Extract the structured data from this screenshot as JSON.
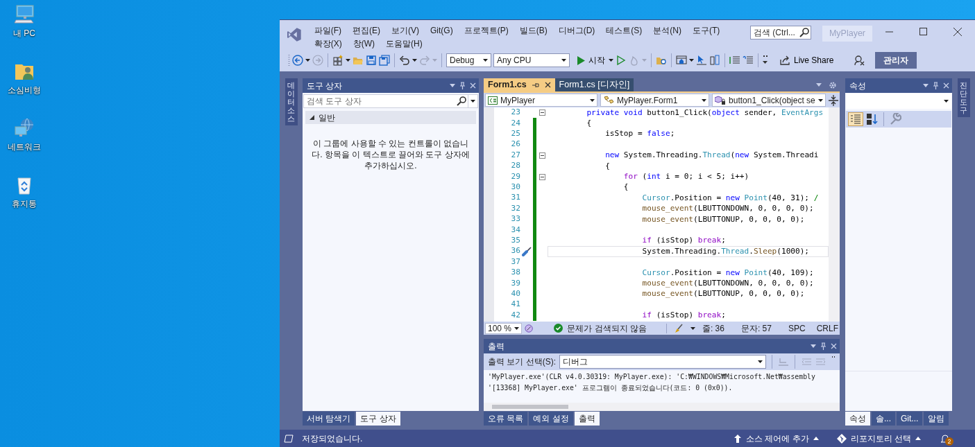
{
  "desktop_icons": [
    {
      "kind": "computer",
      "label": "내 PC"
    },
    {
      "kind": "user-folder",
      "label": "소심비형"
    },
    {
      "kind": "network",
      "label": "네트워크"
    },
    {
      "kind": "recycle-bin",
      "label": "휴지통"
    }
  ],
  "window": {
    "menu": [
      "파일(F)",
      "편집(E)",
      "보기(V)",
      "Git(G)",
      "프로젝트(P)",
      "빌드(B)",
      "디버그(D)",
      "테스트(S)",
      "분석(N)",
      "도구(T)",
      "확장(X)",
      "창(W)",
      "도움말(H)"
    ],
    "search_placeholder": "검색 (Ctrl...",
    "solution": "MyPlayer"
  },
  "toolbar": {
    "configuration": "Debug",
    "platform": "Any CPU",
    "start": "시작",
    "live_share": "Live Share",
    "admin": "관리자"
  },
  "left_strip": {
    "label": "데이터 소스"
  },
  "toolbox": {
    "title": "도구 상자",
    "search_placeholder": "검색 도구 상자",
    "group": {
      "label": "일반",
      "expanded": true
    },
    "message": "이 그룹에 사용할 수 있는 컨트롤이 없습니다. 항목을 이 텍스트로 끌어와 도구 상자에 추가하십시오.",
    "tabs": [
      {
        "label": "서버 탐색기",
        "selected": false
      },
      {
        "label": "도구 상자",
        "selected": true
      }
    ]
  },
  "editor": {
    "tabs": [
      {
        "label": "Form1.cs",
        "selected": true
      },
      {
        "label": "Form1.cs [디자인]",
        "selected": false
      }
    ],
    "nav": {
      "project": "MyPlayer",
      "type": "MyPlayer.Form1",
      "member": "button1_Click(object se"
    },
    "lines": [
      {
        "number": "23",
        "changed": false,
        "fold": true,
        "current": false,
        "segments": [
          {
            "kind": "keyword",
            "text": "        private void"
          },
          {
            "kind": "plain",
            "text": " button1_Click("
          },
          {
            "kind": "keyword",
            "text": "object"
          },
          {
            "kind": "plain",
            "text": " sender, "
          },
          {
            "kind": "type",
            "text": "EventArgs"
          }
        ]
      },
      {
        "number": "24",
        "changed": true,
        "fold": false,
        "current": false,
        "segments": [
          {
            "kind": "plain",
            "text": "        {"
          }
        ]
      },
      {
        "number": "25",
        "changed": true,
        "fold": false,
        "current": false,
        "segments": [
          {
            "kind": "plain",
            "text": "            isStop = "
          },
          {
            "kind": "keyword",
            "text": "false"
          },
          {
            "kind": "plain",
            "text": ";"
          }
        ]
      },
      {
        "number": "26",
        "changed": true,
        "fold": false,
        "current": false
      },
      {
        "number": "27",
        "changed": true,
        "fold": true,
        "current": false,
        "segments": [
          {
            "kind": "keyword",
            "text": "            new"
          },
          {
            "kind": "plain",
            "text": " System.Threading."
          },
          {
            "kind": "type",
            "text": "Thread"
          },
          {
            "kind": "plain",
            "text": "("
          },
          {
            "kind": "keyword",
            "text": "new"
          },
          {
            "kind": "plain",
            "text": " System.Threadi"
          }
        ]
      },
      {
        "number": "28",
        "changed": true,
        "fold": false,
        "current": false,
        "segments": [
          {
            "kind": "plain",
            "text": "            {"
          }
        ]
      },
      {
        "number": "29",
        "changed": true,
        "fold": true,
        "current": false,
        "segments": [
          {
            "kind": "control",
            "text": "                for"
          },
          {
            "kind": "plain",
            "text": " ("
          },
          {
            "kind": "keyword",
            "text": "int"
          },
          {
            "kind": "plain",
            "text": " i = 0; i < 5; i++)"
          }
        ]
      },
      {
        "number": "30",
        "changed": true,
        "fold": false,
        "current": false,
        "segments": [
          {
            "kind": "plain",
            "text": "                {"
          }
        ]
      },
      {
        "number": "31",
        "changed": true,
        "fold": false,
        "current": false,
        "segments": [
          {
            "kind": "type",
            "text": "                    Cursor"
          },
          {
            "kind": "plain",
            "text": ".Position = "
          },
          {
            "kind": "keyword",
            "text": "new"
          },
          {
            "kind": "type",
            "text": " Point"
          },
          {
            "kind": "plain",
            "text": "(40, 31); "
          },
          {
            "kind": "comment",
            "text": "/"
          }
        ]
      },
      {
        "number": "32",
        "changed": true,
        "fold": false,
        "current": false,
        "segments": [
          {
            "kind": "method",
            "text": "                    mouse_event"
          },
          {
            "kind": "plain",
            "text": "(LBUTTONDOWN, 0, 0, 0, 0);"
          }
        ]
      },
      {
        "number": "33",
        "changed": true,
        "fold": false,
        "current": false,
        "segments": [
          {
            "kind": "method",
            "text": "                    mouse_event"
          },
          {
            "kind": "plain",
            "text": "(LBUTTONUP, 0, 0, 0, 0);"
          }
        ]
      },
      {
        "number": "34",
        "changed": true,
        "fold": false,
        "current": false
      },
      {
        "number": "35",
        "changed": true,
        "fold": false,
        "current": false,
        "segments": [
          {
            "kind": "control",
            "text": "                    if"
          },
          {
            "kind": "plain",
            "text": " (isStop) "
          },
          {
            "kind": "control",
            "text": "break"
          },
          {
            "kind": "plain",
            "text": ";"
          }
        ]
      },
      {
        "number": "36",
        "changed": true,
        "fold": false,
        "current": true,
        "segments": [
          {
            "kind": "plain",
            "text": "                    System.Threading."
          },
          {
            "kind": "type",
            "text": "Thread"
          },
          {
            "kind": "plain",
            "text": "."
          },
          {
            "kind": "method",
            "text": "Sleep"
          },
          {
            "kind": "plain",
            "text": "(1000);"
          }
        ]
      },
      {
        "number": "37",
        "changed": true,
        "fold": false,
        "current": false
      },
      {
        "number": "38",
        "changed": true,
        "fold": false,
        "current": false,
        "segments": [
          {
            "kind": "type",
            "text": "                    Cursor"
          },
          {
            "kind": "plain",
            "text": ".Position = "
          },
          {
            "kind": "keyword",
            "text": "new"
          },
          {
            "kind": "type",
            "text": " Point"
          },
          {
            "kind": "plain",
            "text": "(40, 109);"
          }
        ]
      },
      {
        "number": "39",
        "changed": true,
        "fold": false,
        "current": false,
        "segments": [
          {
            "kind": "method",
            "text": "                    mouse_event"
          },
          {
            "kind": "plain",
            "text": "(LBUTTONDOWN, 0, 0, 0, 0);"
          }
        ]
      },
      {
        "number": "40",
        "changed": true,
        "fold": false,
        "current": false,
        "segments": [
          {
            "kind": "method",
            "text": "                    mouse_event"
          },
          {
            "kind": "plain",
            "text": "(LBUTTONUP, 0, 0, 0, 0);"
          }
        ]
      },
      {
        "number": "41",
        "changed": true,
        "fold": false,
        "current": false
      },
      {
        "number": "42",
        "changed": true,
        "fold": false,
        "current": false,
        "segments": [
          {
            "kind": "control",
            "text": "                    if"
          },
          {
            "kind": "plain",
            "text": " (isStop) "
          },
          {
            "kind": "control",
            "text": "break"
          },
          {
            "kind": "plain",
            "text": ";"
          }
        ]
      }
    ],
    "status": {
      "zoom": "100 %",
      "issues": "문제가 검색되지 않음",
      "line": "줄: 36",
      "column": "문자: 57",
      "whitespace": "SPC",
      "line_ending": "CRLF"
    }
  },
  "output": {
    "title": "출력",
    "source_label": "출력 보기 선택(S):",
    "source": "디버그",
    "lines": [
      "'MyPlayer.exe'(CLR v4.0.30319: MyPlayer.exe): 'C:₩WINDOWS₩Microsoft.Net₩assembly",
      "'[13368] MyPlayer.exe' 프로그램이 종료되었습니다(코드: 0 (0x0))."
    ],
    "tabs": [
      {
        "label": "오류 목록",
        "selected": false
      },
      {
        "label": "예외 설정",
        "selected": false
      },
      {
        "label": "출력",
        "selected": true
      }
    ]
  },
  "properties": {
    "title": "속성",
    "tabs": [
      {
        "label": "속성",
        "selected": true
      },
      {
        "label": "솔...",
        "selected": false
      },
      {
        "label": "Git...",
        "selected": false
      },
      {
        "label": "알림",
        "selected": false
      }
    ]
  },
  "right_strip": {
    "label": "진단 도구"
  },
  "status_bar": {
    "message": "저장되었습니다.",
    "source_control": "소스 제어에 추가",
    "repository": "리포지토리 선택",
    "notifications": "2"
  }
}
